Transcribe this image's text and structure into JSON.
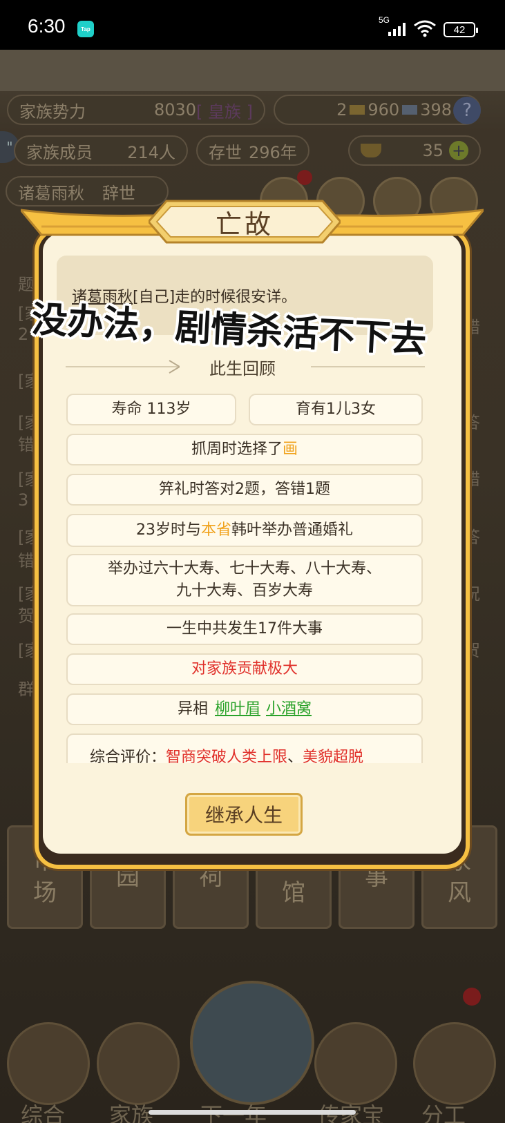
{
  "status_bar": {
    "time": "6:30",
    "app_badge": "Tap",
    "network": "5G",
    "battery": "42"
  },
  "hud": {
    "power_label": "家族势力",
    "power_value": "8030",
    "power_rank": "[ 皇族 ]",
    "currency_a": "2",
    "currency_b": "960",
    "currency_c": "398",
    "members_label": "家族成员",
    "members_value": "214人",
    "years_label": "存世",
    "years_value": "296年",
    "gold": "35",
    "current_person": "诸葛雨秋",
    "current_status": "辞世"
  },
  "bg_list": [
    {
      "l": "题",
      "r": ""
    },
    {
      "l": "[家",
      "r": "错"
    },
    {
      "l": "2",
      "r": ""
    },
    {
      "l": "[家",
      "r": ""
    },
    {
      "l": "[家",
      "r": "答"
    },
    {
      "l": "错",
      "r": ""
    },
    {
      "l": "[家",
      "r": "错"
    },
    {
      "l": "3",
      "r": ""
    },
    {
      "l": "[家",
      "r": "答"
    },
    {
      "l": "错",
      "r": ""
    },
    {
      "l": "[家",
      "r": "祝"
    },
    {
      "l": "贺",
      "r": ""
    },
    {
      "l": "[家",
      "r": "贺"
    },
    {
      "l": "群",
      "r": ""
    }
  ],
  "bg_tabs": [
    "市\n场",
    "园",
    "祠",
    "娘\n馆",
    "事",
    "家\n风"
  ],
  "bg_nav": [
    "综合",
    "家族",
    "下一年",
    "传家宝",
    "分工"
  ],
  "modal": {
    "title": "亡故",
    "message_name": "诸葛雨秋",
    "message_rest": "[自己]走的时候很安详。",
    "section_title": "此生回顾",
    "lifespan": "寿命 113岁",
    "children": "育有1儿3女",
    "zhuazhou_prefix": "抓周时选择了",
    "zhuazhou_choice": "画",
    "ji_li": "笄礼时答对2题，答错1题",
    "marriage_prefix": "23岁时与",
    "marriage_place": "本省",
    "marriage_suffix": "韩叶举办普通婚礼",
    "birthdays_line1": "举办过六十大寿、七十大寿、八十大寿、",
    "birthdays_line2": "九十大寿、百岁大寿",
    "events": "一生中共发生17件大事",
    "contribution": "对家族贡献极大",
    "traits_label": "异相",
    "trait_1": "柳叶眉",
    "trait_2": "小酒窝",
    "eval_label": "综合评价：",
    "eval_1": "智商突破人类上限",
    "eval_sep": "、",
    "eval_2": "美貌超脱",
    "inherit_button": "继承人生"
  },
  "overlay_caption": "没办法，剧情杀活不下去",
  "colors": {
    "accent_orange": "#f0a21c",
    "accent_red": "#e0302a",
    "accent_green": "#2aa22a",
    "frame_gold": "#f6c042",
    "panel_cream": "#fbf3dc"
  }
}
